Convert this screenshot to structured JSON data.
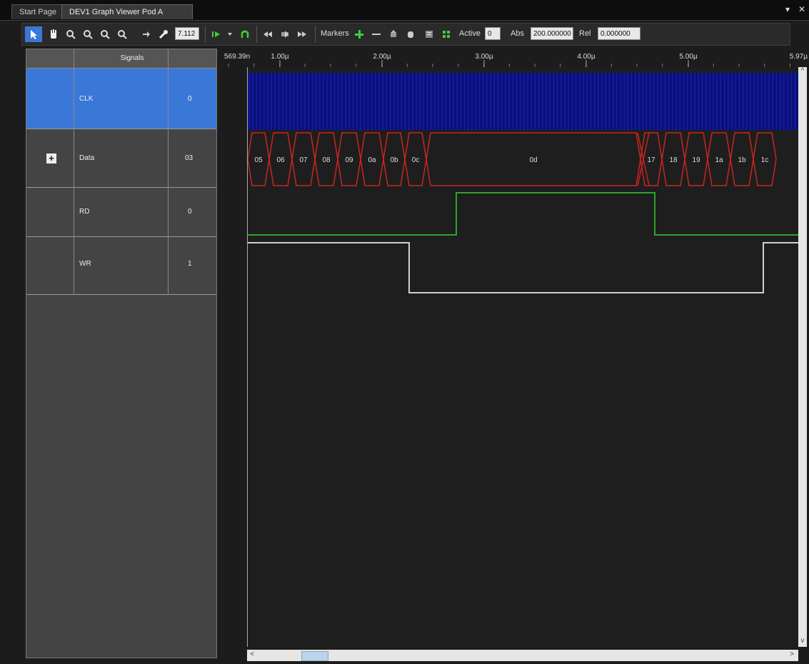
{
  "tabs": {
    "start": "Start Page",
    "active": "DEV1 Graph Viewer Pod A",
    "dropdown_icon": "▾",
    "close_icon": "✕"
  },
  "toolbar": {
    "zoom_value": "7.112",
    "markers_label": "Markers",
    "active_label": "Active",
    "active_value": "0",
    "abs_label": "Abs",
    "abs_value": "200.000000",
    "rel_label": "Rel",
    "rel_value": "0.000000",
    "accent_green": "#3fcf3f",
    "accent_blue": "#3a78d8"
  },
  "signals": {
    "header": "Signals",
    "rows": [
      {
        "name": "CLK",
        "value": "0",
        "expandable": false,
        "selected": true
      },
      {
        "name": "Data",
        "value": "03",
        "expandable": true,
        "selected": false
      },
      {
        "name": "RD",
        "value": "0",
        "expandable": false,
        "selected": false
      },
      {
        "name": "WR",
        "value": "1",
        "expandable": false,
        "selected": false
      }
    ]
  },
  "ruler": {
    "start_label": "569.39n",
    "ticks": [
      "1.00µ",
      "2.00µ",
      "3.00µ",
      "4.00µ",
      "5.00µ"
    ],
    "end_label": "5.97µ"
  },
  "waveform": {
    "data_segments": [
      "05",
      "06",
      "07",
      "08",
      "09",
      "0a",
      "0b",
      "0c",
      "0d",
      "17",
      "18",
      "19",
      "1a",
      "1b",
      "1c"
    ],
    "colors": {
      "clk": "#0a0f7a",
      "data": "#c8261e",
      "rd": "#2fa32f",
      "wr": "#cfcfcf"
    }
  }
}
